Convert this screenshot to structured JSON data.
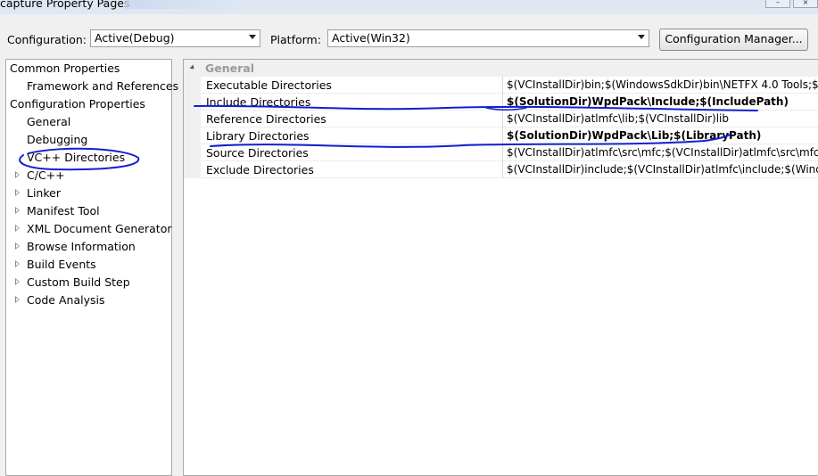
{
  "window": {
    "title": "capture Property Pages",
    "minimize_glyph": "–",
    "close_glyph": "×"
  },
  "toolbar": {
    "configuration_label": "Configuration:",
    "configuration_value": "Active(Debug)",
    "platform_label": "Platform:",
    "platform_value": "Active(Win32)",
    "config_manager_label": "Configuration Manager..."
  },
  "tree": {
    "items": [
      {
        "label": "Common Properties",
        "expandable": false
      },
      {
        "label": "Framework and References",
        "expandable": false
      },
      {
        "label": "Configuration Properties",
        "expandable": false
      },
      {
        "label": "General",
        "expandable": false
      },
      {
        "label": "Debugging",
        "expandable": false
      },
      {
        "label": "VC++ Directories",
        "expandable": false,
        "selected": true
      },
      {
        "label": "C/C++",
        "expandable": true
      },
      {
        "label": "Linker",
        "expandable": true
      },
      {
        "label": "Manifest Tool",
        "expandable": true
      },
      {
        "label": "XML Document Generator",
        "expandable": true
      },
      {
        "label": "Browse Information",
        "expandable": true
      },
      {
        "label": "Build Events",
        "expandable": true
      },
      {
        "label": "Custom Build Step",
        "expandable": true
      },
      {
        "label": "Code Analysis",
        "expandable": true
      }
    ]
  },
  "grid": {
    "category": "General",
    "rows": [
      {
        "name": "Executable Directories",
        "value": "$(VCInstallDir)bin;$(WindowsSdkDir)bin\\NETFX 4.0 Tools;$(Win",
        "bold": false
      },
      {
        "name": "Include Directories",
        "value": "$(SolutionDir)WpdPack\\Include;$(IncludePath)",
        "bold": true
      },
      {
        "name": "Reference Directories",
        "value": "$(VCInstallDir)atlmfc\\lib;$(VCInstallDir)lib",
        "bold": false
      },
      {
        "name": "Library Directories",
        "value": "$(SolutionDir)WpdPack\\Lib;$(LibraryPath)",
        "bold": true
      },
      {
        "name": "Source Directories",
        "value": "$(VCInstallDir)atlmfc\\src\\mfc;$(VCInstallDir)atlmfc\\src\\mfcm;$(",
        "bold": false
      },
      {
        "name": "Exclude Directories",
        "value": "$(VCInstallDir)include;$(VCInstallDir)atlmfc\\include;$(WindowsS",
        "bold": false
      }
    ]
  },
  "annotations": {
    "stroke_color": "#1020d0"
  }
}
